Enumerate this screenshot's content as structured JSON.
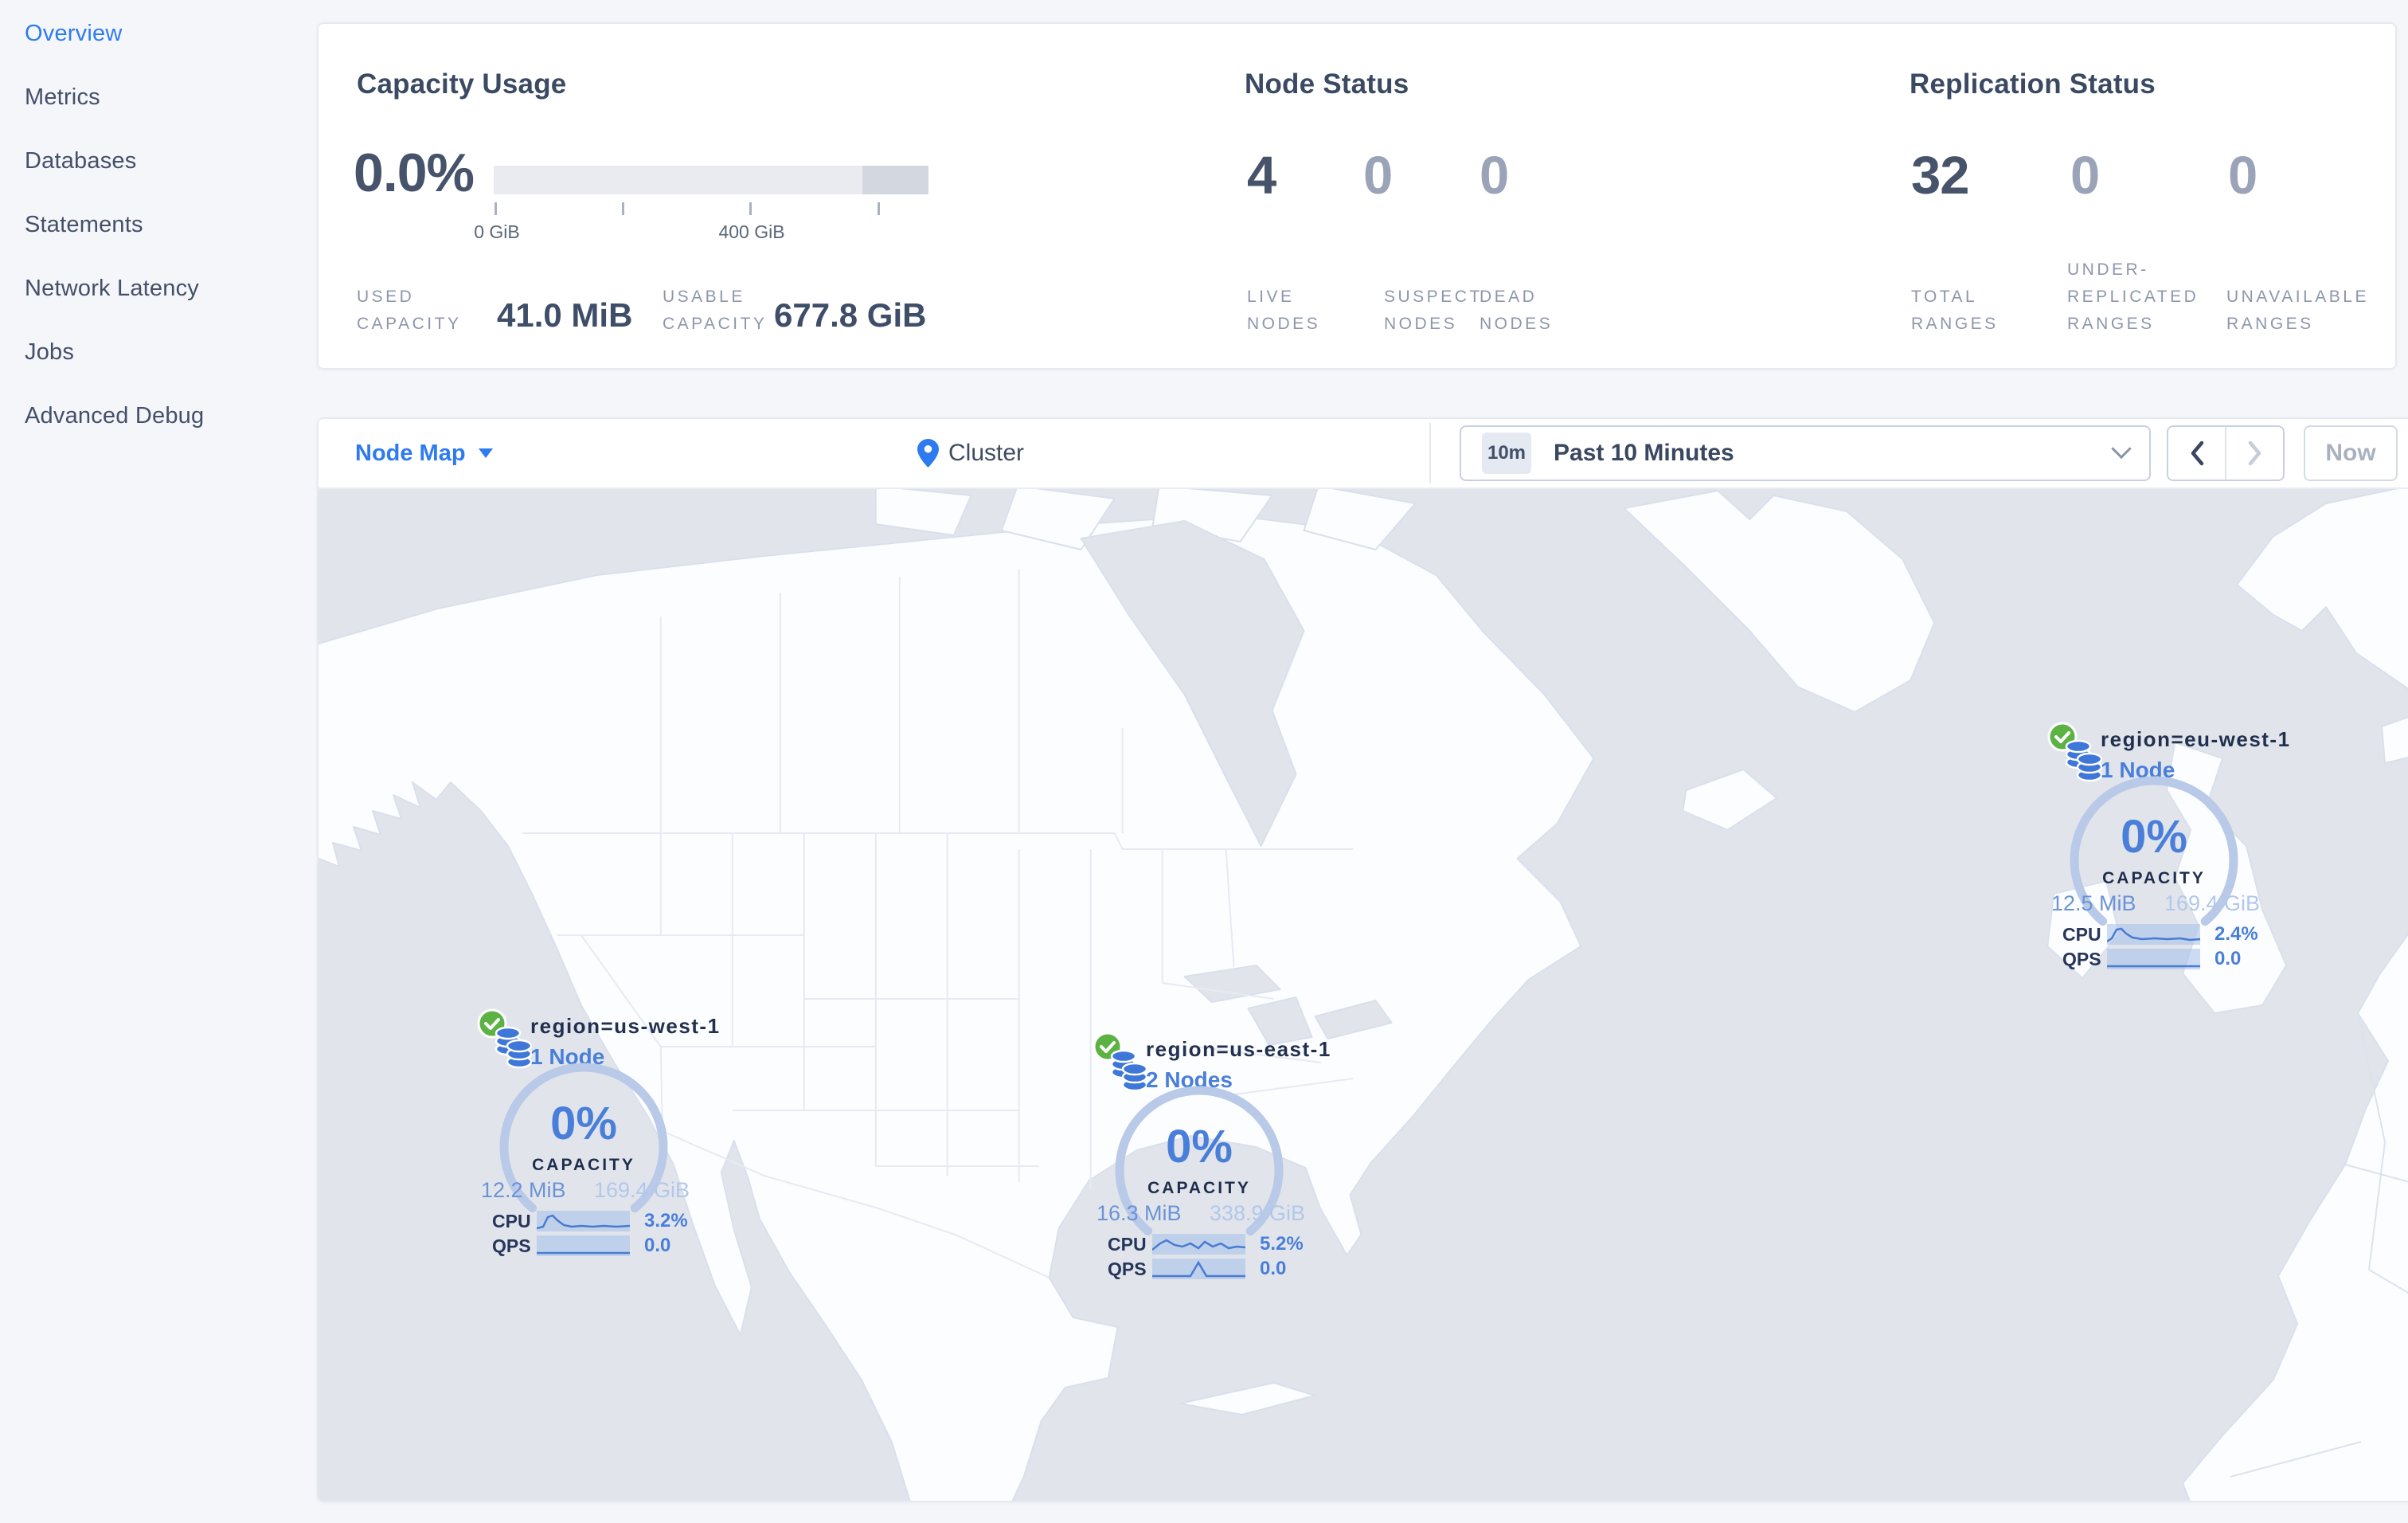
{
  "colors": {
    "accent_blue": "#2e7bf0",
    "healthy_green": "#5cb344",
    "gauge_arc": "#b9c9e8",
    "spark_line": "#4a7bd1",
    "heading_slate": "#3b4a63",
    "muted_label": "#8d96ab",
    "map_ocean": "#e1e5eb",
    "map_land": "#fcfdff"
  },
  "sidebar": {
    "items": [
      {
        "label": "Overview",
        "active": true
      },
      {
        "label": "Metrics",
        "active": false
      },
      {
        "label": "Databases",
        "active": false
      },
      {
        "label": "Statements",
        "active": false
      },
      {
        "label": "Network Latency",
        "active": false
      },
      {
        "label": "Jobs",
        "active": false
      },
      {
        "label": "Advanced Debug",
        "active": false
      }
    ]
  },
  "summary": {
    "capacity": {
      "title": "Capacity Usage",
      "percent": "0.0%",
      "tick_label_0": "0 GiB",
      "tick_label_400": "400 GiB",
      "used_label": "USED\nCAPACITY",
      "used_value": "41.0 MiB",
      "usable_label": "USABLE\nCAPACITY",
      "usable_value": "677.8 GiB"
    },
    "node_status": {
      "title": "Node Status",
      "live": "4",
      "suspect": "0",
      "dead": "0",
      "live_label": "LIVE\nNODES",
      "suspect_label": "SUSPECT\nNODES",
      "dead_label": "DEAD\nNODES"
    },
    "replication": {
      "title": "Replication Status",
      "total": "32",
      "under_replicated": "0",
      "unavailable": "0",
      "total_label": "TOTAL\nRANGES",
      "under_label": "UNDER-\nREPLICATED\nRANGES",
      "unavailable_label": "UNAVAILABLE\nRANGES"
    }
  },
  "toolbar": {
    "view_selector": "Node Map",
    "breadcrumb": "Cluster",
    "time_badge": "10m",
    "time_range": "Past 10 Minutes",
    "now_button": "Now"
  },
  "map_nodes": [
    {
      "region": "region=us-west-1",
      "nodes_label": "1 Node",
      "percent": "0%",
      "capacity_label": "CAPACITY",
      "used": "12.2 MiB",
      "capacity_total": "169.4 GiB",
      "cpu_label": "CPU",
      "cpu_value": "3.2%",
      "qps_label": "QPS",
      "qps_value": "0.0"
    },
    {
      "region": "region=us-east-1",
      "nodes_label": "2 Nodes",
      "percent": "0%",
      "capacity_label": "CAPACITY",
      "used": "16.3 MiB",
      "capacity_total": "338.9 GiB",
      "cpu_label": "CPU",
      "cpu_value": "5.2%",
      "qps_label": "QPS",
      "qps_value": "0.0"
    },
    {
      "region": "region=eu-west-1",
      "nodes_label": "1 Node",
      "percent": "0%",
      "capacity_label": "CAPACITY",
      "used": "12.5 MiB",
      "capacity_total": "169.4 GiB",
      "cpu_label": "CPU",
      "cpu_value": "2.4%",
      "qps_label": "QPS",
      "qps_value": "0.0"
    }
  ]
}
